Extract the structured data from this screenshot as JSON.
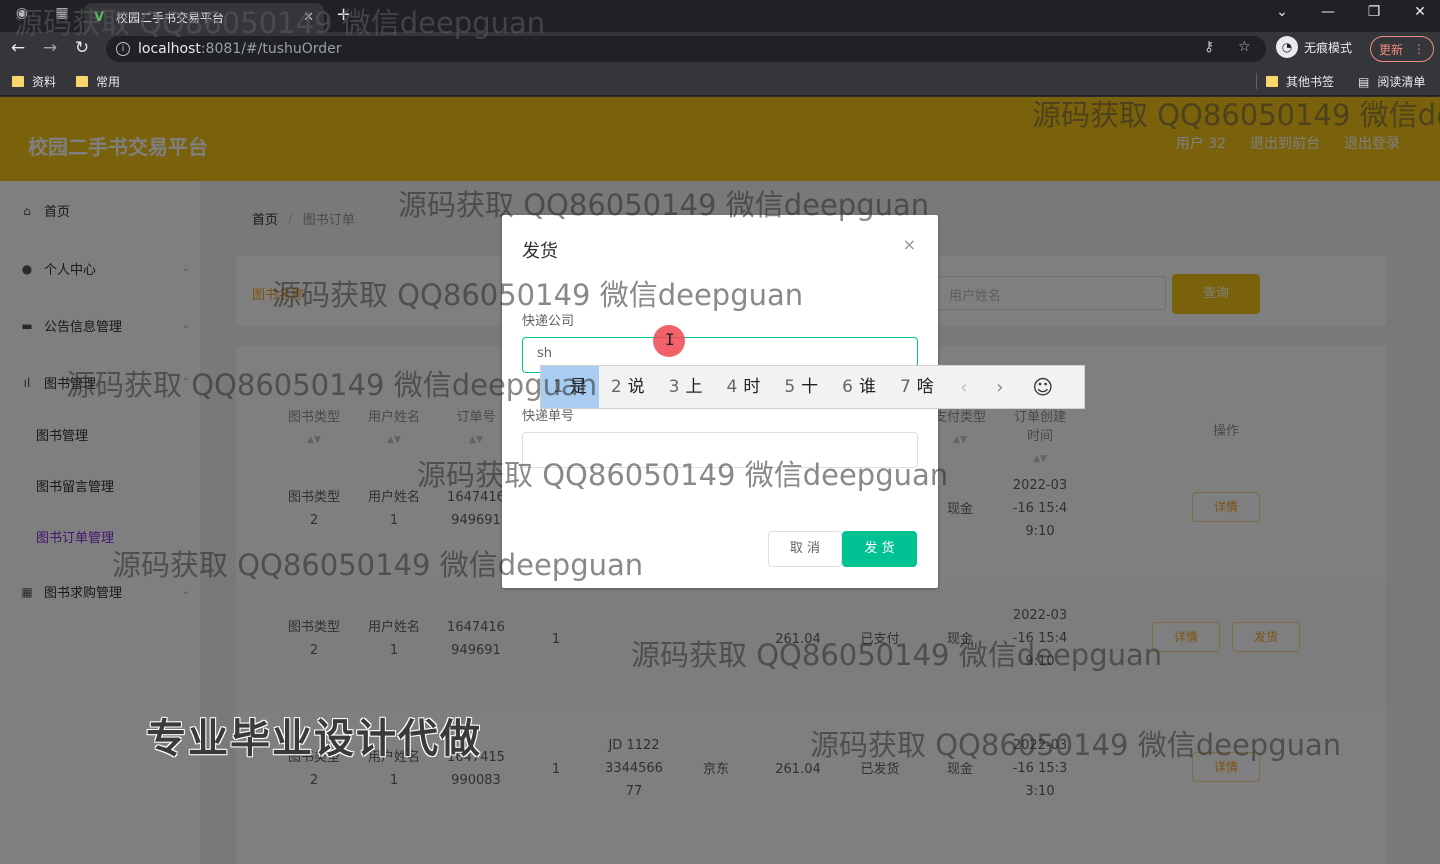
{
  "browser": {
    "tab_title": "校园二手书交易平台",
    "url_host": "localhost",
    "url_rest": ":8081/#/tushuOrder",
    "incognito_label": "无痕模式",
    "update_label": "更新",
    "bookmarks": [
      "资料",
      "常用"
    ],
    "other_bookmarks": "其他书签",
    "reading_list": "阅读清单"
  },
  "app": {
    "brand": "校园二手书交易平台",
    "header_links": [
      "用户 32",
      "退出到前台",
      "退出登录"
    ],
    "sidebar": {
      "home": "首页",
      "personal": "个人中心",
      "notice": "公告信息管理",
      "book_group": "图书管理",
      "book_mgmt": "图书管理",
      "book_msg": "图书留言管理",
      "book_order": "图书订单管理",
      "book_buy": "图书求购管理"
    },
    "breadcrumb": {
      "home": "首页",
      "current": "图书订单"
    },
    "search": {
      "label": "图书名称",
      "placeholder": "用户姓名",
      "button": "查询"
    },
    "table": {
      "headers": [
        "图书类型",
        "用户姓名",
        "订单号",
        "支付类型",
        "订单创建时间",
        "操作"
      ],
      "rows": [
        {
          "type": "图书类型 2",
          "user": "用户姓名 1",
          "order": "1647416 949691",
          "qty": "",
          "express": "",
          "no": "",
          "price": "",
          "status": "",
          "pay": "现金",
          "time": "2022-03 -16 15:4 9:10",
          "ops": [
            "详情"
          ]
        },
        {
          "type": "图书类型 2",
          "user": "用户姓名 1",
          "order": "1647416 949691",
          "qty": "1",
          "express": "",
          "no": "",
          "price": "261.04",
          "status": "已支付",
          "pay": "现金",
          "time": "2022-03 -16 15:4 9:10",
          "ops": [
            "详情",
            "发货"
          ]
        },
        {
          "type": "图书类型 2",
          "user": "用户姓名 1",
          "order": "1647415 990083",
          "qty": "1",
          "express": "京东",
          "no": "JD 1122 3344566 77",
          "price": "261.04",
          "status": "已发货",
          "pay": "现金",
          "time": "2022-03 -16 15:3 3:10",
          "ops": [
            "详情"
          ]
        }
      ]
    }
  },
  "dialog": {
    "title": "发货",
    "close": "×",
    "fields": [
      {
        "label": "快递公司",
        "value": "sh"
      },
      {
        "label": "快递单号",
        "value": ""
      }
    ],
    "cancel": "取 消",
    "confirm": "发 货"
  },
  "ime": {
    "candidates": [
      {
        "n": "1",
        "w": "是"
      },
      {
        "n": "2",
        "w": "说"
      },
      {
        "n": "3",
        "w": "上"
      },
      {
        "n": "4",
        "w": "时"
      },
      {
        "n": "5",
        "w": "十"
      },
      {
        "n": "6",
        "w": "谁"
      },
      {
        "n": "7",
        "w": "啥"
      }
    ]
  },
  "watermarks": {
    "text": "源码获取 QQ86050149 微信deepguan",
    "big": "专业毕业设计代做"
  }
}
